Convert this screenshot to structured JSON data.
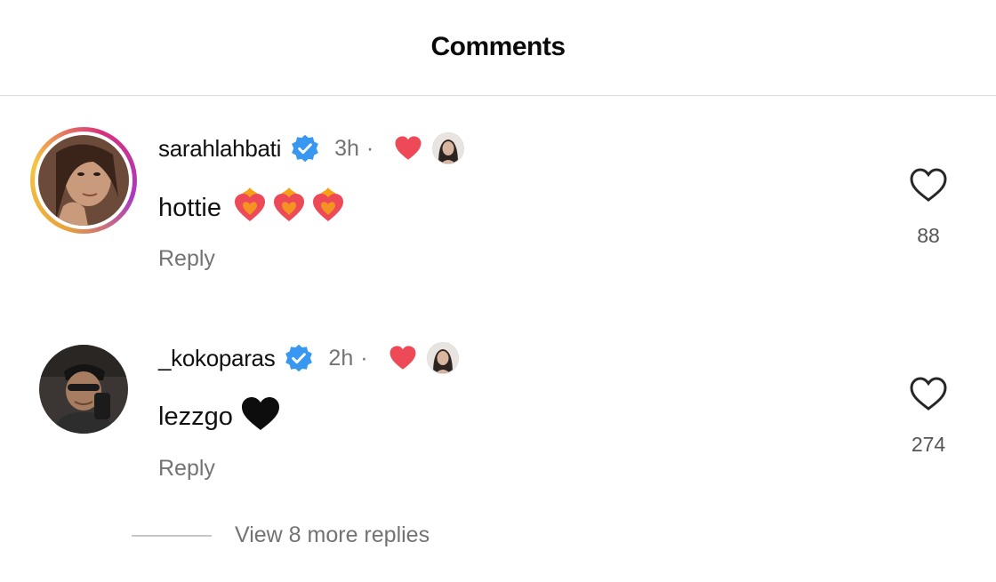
{
  "header": {
    "title": "Comments"
  },
  "comments": [
    {
      "username": "sarahlahbati",
      "time": "3h",
      "separator": "·",
      "text": "hottie",
      "reply_label": "Reply",
      "like_count": "88",
      "has_story_ring": true
    },
    {
      "username": "_kokoparas",
      "time": "2h",
      "separator": "·",
      "text": "lezzgo",
      "reply_label": "Reply",
      "like_count": "274",
      "has_story_ring": false
    }
  ],
  "view_more": {
    "label": "View 8 more replies"
  },
  "icons": {
    "verified": "verified-badge-icon",
    "author_liked": "red-heart-icon",
    "like": "heart-outline-icon",
    "fire_heart": "heart-on-fire-emoji",
    "black_heart": "black-heart-emoji"
  },
  "colors": {
    "verified_blue": "#3897f0",
    "heart_red": "#ed4956",
    "muted_text": "#737373"
  }
}
